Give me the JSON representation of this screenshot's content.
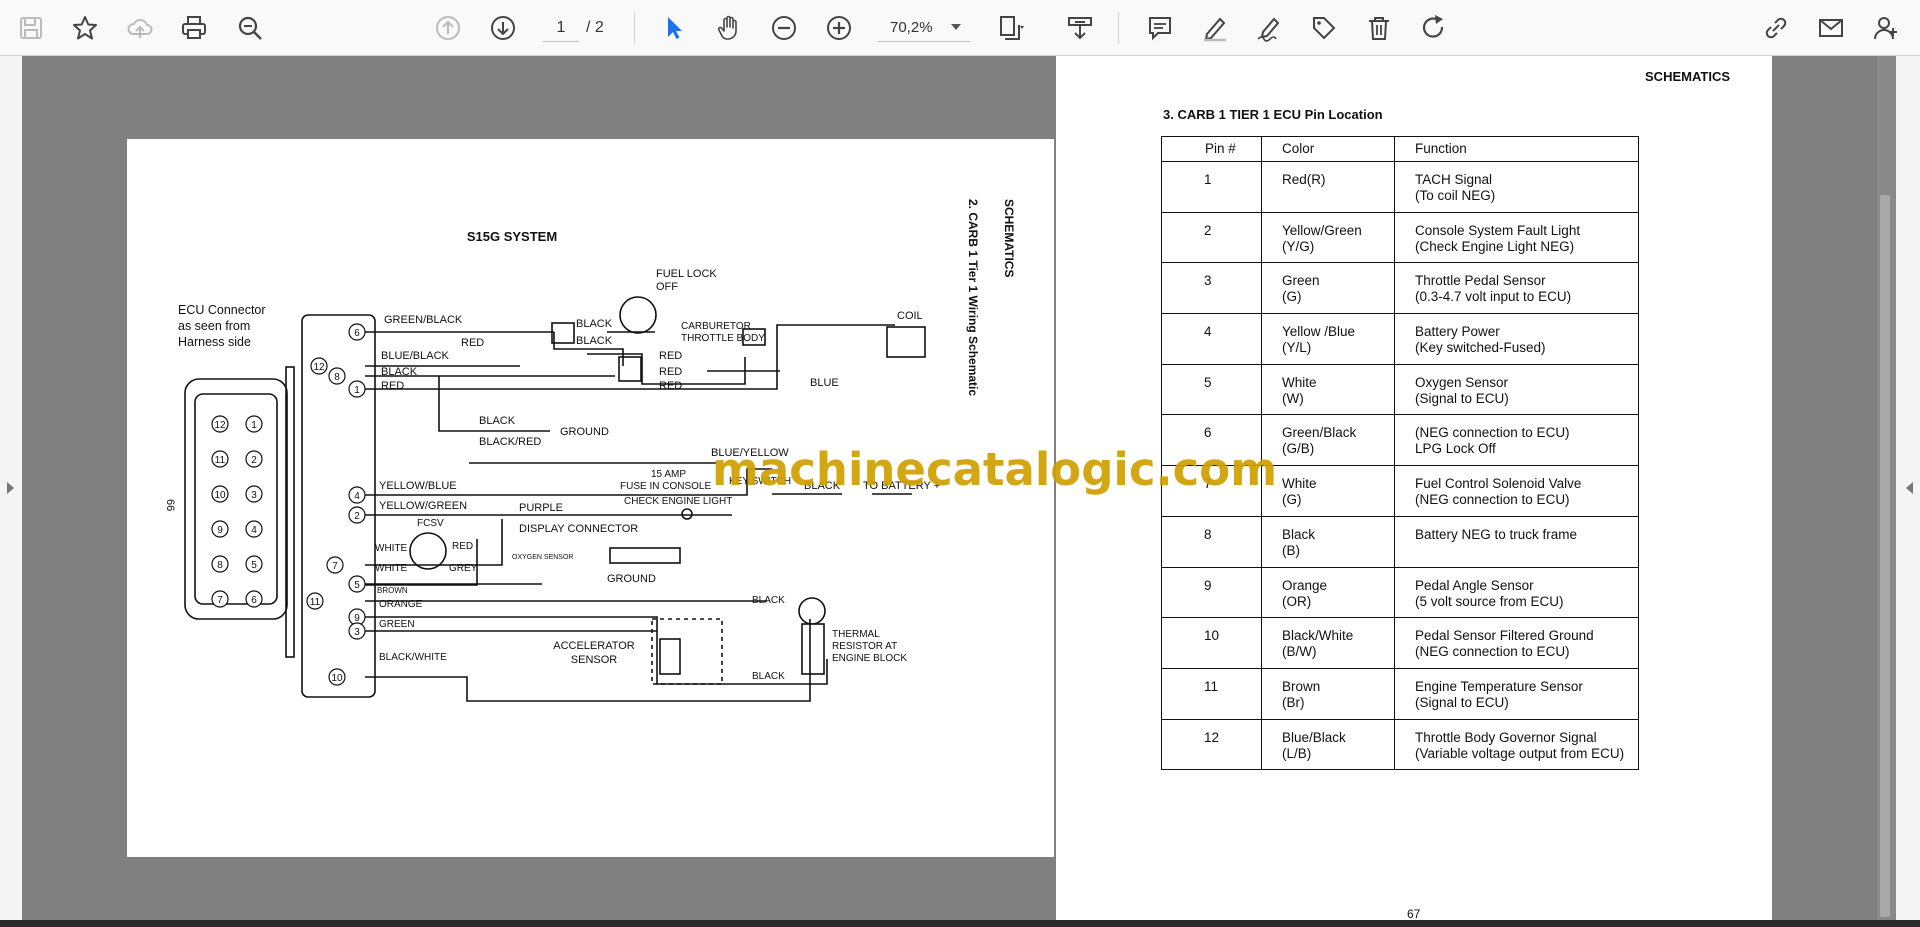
{
  "toolbar": {
    "page_current": "1",
    "page_total": "/ 2",
    "zoom": "70,2%",
    "icons": [
      "save-icon",
      "bookmark-star-icon",
      "upload-cloud-icon",
      "print-icon",
      "zoom-search-icon",
      "prev-page-icon",
      "next-page-icon",
      "select-cursor-icon",
      "hand-tool-icon",
      "zoom-out-icon",
      "zoom-in-icon",
      "fit-page-icon",
      "stamp-icon",
      "comment-icon",
      "pen-icon",
      "signature-icon",
      "tag-edit-icon",
      "delete-icon",
      "rotate-icon",
      "share-link-icon",
      "email-icon",
      "add-user-icon"
    ]
  },
  "left_page": {
    "side_header": "SCHEMATICS",
    "side_title": "2. CARB 1 Tier 1 Wiring Schematic",
    "side_number": "66",
    "system_title": "S15G SYSTEM",
    "connector_caption": [
      "ECU Connector",
      "as seen from",
      "Harness side"
    ],
    "pin_left_col": [
      "12",
      "11",
      "10",
      "9",
      "8",
      "7"
    ],
    "pin_right_col": [
      "1",
      "2",
      "3",
      "4",
      "5",
      "6"
    ],
    "pins_on_bar": [
      "6",
      "12",
      "8",
      "1",
      "4",
      "2",
      "7",
      "5",
      "11",
      "9",
      "3",
      "10"
    ],
    "labels": {
      "fuel_lock": [
        "FUEL LOCK",
        "OFF"
      ],
      "carburetor": [
        "CARBURETOR",
        "THROTTLE BODY"
      ],
      "coil": "COIL",
      "green_black": "GREEN/BLACK",
      "blue_black": "BLUE/BLACK",
      "black": "BLACK",
      "red": "RED",
      "blue": "BLUE",
      "ground": "GROUND",
      "black_red": "BLACK/RED",
      "blue_yellow": "BLUE/YELLOW",
      "amp_15": "15 AMP",
      "fuse_console": "FUSE IN CONSOLE",
      "check_engine": "CHECK ENGINE LIGHT",
      "key_switch": "KEY SWITCH",
      "to_battery": "TO BATTERY +",
      "yellow_blue": "YELLOW/BLUE",
      "yellow_green": "YELLOW/GREEN",
      "purple": "PURPLE",
      "display_connector": "DISPLAY CONNECTOR",
      "fcsv": "FCSV",
      "white": "WHITE",
      "grey": "GREY",
      "oxygen_sensor": "OXYGEN SENSOR",
      "brown": "BROWN",
      "orange": "ORANGE",
      "green": "GREEN",
      "black_white": "BLACK/WHITE",
      "accel_sensor": [
        "ACCELERATOR",
        "SENSOR"
      ],
      "thermal": [
        "THERMAL",
        "RESISTOR AT",
        "ENGINE BLOCK"
      ]
    }
  },
  "right_page": {
    "header": "SCHEMATICS",
    "section_title": "3. CARB 1 TIER 1 ECU Pin Location",
    "columns": [
      "Pin #",
      "Color",
      "Function"
    ],
    "rows": [
      {
        "pin": "1",
        "color": [
          "Red(R)",
          ""
        ],
        "function": [
          "TACH Signal",
          "(To coil NEG)"
        ]
      },
      {
        "pin": "2",
        "color": [
          "Yellow/Green",
          "(Y/G)"
        ],
        "function": [
          "Console System Fault Light",
          "(Check Engine Light NEG)"
        ]
      },
      {
        "pin": "3",
        "color": [
          "Green",
          "(G)"
        ],
        "function": [
          "Throttle Pedal Sensor",
          "(0.3-4.7 volt input to ECU)"
        ]
      },
      {
        "pin": "4",
        "color": [
          "Yellow /Blue",
          "(Y/L)"
        ],
        "function": [
          "Battery Power",
          "(Key switched-Fused)"
        ]
      },
      {
        "pin": "5",
        "color": [
          "White",
          "(W)"
        ],
        "function": [
          "Oxygen Sensor",
          "(Signal to ECU)"
        ]
      },
      {
        "pin": "6",
        "color": [
          "Green/Black",
          "(G/B)"
        ],
        "function": [
          "(NEG connection to ECU)",
          "LPG Lock Off"
        ]
      },
      {
        "pin": "7",
        "color": [
          "White",
          "(G)"
        ],
        "function": [
          "Fuel Control Solenoid Valve",
          "(NEG connection to ECU)"
        ]
      },
      {
        "pin": "8",
        "color": [
          "Black",
          "(B)"
        ],
        "function": [
          "Battery NEG to truck frame",
          ""
        ]
      },
      {
        "pin": "9",
        "color": [
          "Orange",
          "(OR)"
        ],
        "function": [
          "Pedal Angle Sensor",
          "(5 volt source from ECU)"
        ]
      },
      {
        "pin": "10",
        "color": [
          "Black/White",
          "(B/W)"
        ],
        "function": [
          "Pedal Sensor Filtered Ground",
          "(NEG connection to ECU)"
        ]
      },
      {
        "pin": "11",
        "color": [
          "Brown",
          "(Br)"
        ],
        "function": [
          "Engine Temperature Sensor",
          "(Signal to ECU)"
        ]
      },
      {
        "pin": "12",
        "color": [
          "Blue/Black",
          "(L/B)"
        ],
        "function": [
          "Throttle Body Governor Signal",
          "(Variable voltage output from ECU)"
        ]
      }
    ],
    "page_number": "67"
  },
  "watermark": "machinecatalogic.com",
  "colors": {
    "toolbar_bg": "#f9f9fa",
    "viewer_bg": "#808080",
    "icon_active": "#1a73e8",
    "watermark": "#d0a000"
  }
}
